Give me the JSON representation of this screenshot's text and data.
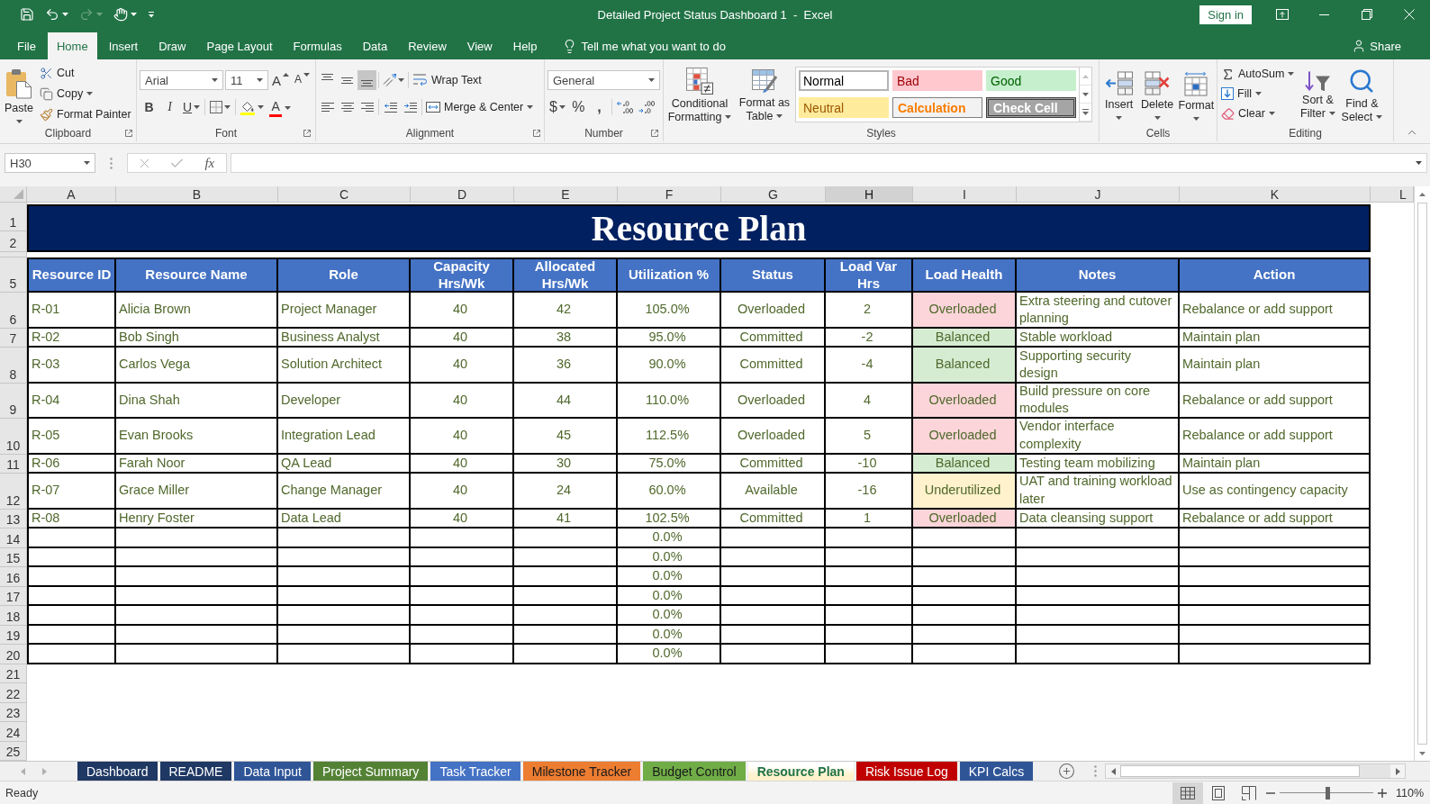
{
  "title_bar": {
    "quick_access": [
      {
        "kind": "save",
        "disabled": false
      },
      {
        "kind": "undo",
        "disabled": false
      },
      {
        "kind": "redo",
        "disabled": true
      },
      {
        "kind": "touch",
        "disabled": false
      }
    ],
    "title": "Detailed Project Status Dashboard 1  -  Excel",
    "sign_in": "Sign in"
  },
  "menu": {
    "tabs": [
      {
        "label": "File",
        "selected": false
      },
      {
        "label": "Home",
        "selected": true
      },
      {
        "label": "Insert",
        "selected": false
      },
      {
        "label": "Draw",
        "selected": false
      },
      {
        "label": "Page Layout",
        "selected": false
      },
      {
        "label": "Formulas",
        "selected": false
      },
      {
        "label": "Data",
        "selected": false
      },
      {
        "label": "Review",
        "selected": false
      },
      {
        "label": "View",
        "selected": false
      },
      {
        "label": "Help",
        "selected": false
      }
    ],
    "tell_me": "Tell me what you want to do",
    "share": "Share"
  },
  "ribbon": {
    "clipboard": {
      "label": "Clipboard",
      "paste": "Paste",
      "cut": "Cut",
      "copy": "Copy",
      "format_painter": "Format Painter"
    },
    "font": {
      "label": "Font",
      "font_name": "Arial",
      "font_size": "11",
      "grow": "A",
      "shrink": "A",
      "bold": "B",
      "italic": "I",
      "underline": "U",
      "font_color": "A"
    },
    "alignment": {
      "label": "Alignment",
      "vertical": [
        {
          "kind": "top",
          "selected": false
        },
        {
          "kind": "middle",
          "selected": false
        },
        {
          "kind": "bottom",
          "selected": true
        }
      ],
      "wrap_text": "Wrap Text",
      "merge_center": "Merge & Center"
    },
    "number": {
      "label": "Number",
      "format": "General",
      "currency": "$",
      "percent": "%",
      "comma": ","
    },
    "styles": {
      "label": "Styles",
      "conditional_formatting": "Conditional Formatting",
      "format_as_table": "Format as Table",
      "gallery": [
        {
          "label": "Normal",
          "kind": "normal",
          "selected": true
        },
        {
          "label": "Bad",
          "kind": "bad",
          "selected": false
        },
        {
          "label": "Good",
          "kind": "good",
          "selected": false
        },
        {
          "label": "Neutral",
          "kind": "neutral",
          "selected": false
        },
        {
          "label": "Calculation",
          "kind": "calculation",
          "selected": false
        },
        {
          "label": "Check Cell",
          "kind": "check",
          "selected": false
        }
      ]
    },
    "cells": {
      "label": "Cells",
      "insert": "Insert",
      "delete": "Delete",
      "format": "Format"
    },
    "editing": {
      "label": "Editing",
      "autosum": "AutoSum",
      "fill": "Fill",
      "clear": "Clear",
      "sort_filter": "Sort & Filter",
      "find_select": "Find & Select"
    }
  },
  "formula_bar": {
    "name_box": "H30",
    "function": "fx"
  },
  "sheet": {
    "columns": [
      {
        "label": "A",
        "selected": false
      },
      {
        "label": "B",
        "selected": false
      },
      {
        "label": "C",
        "selected": false
      },
      {
        "label": "D",
        "selected": false
      },
      {
        "label": "E",
        "selected": false
      },
      {
        "label": "F",
        "selected": false
      },
      {
        "label": "G",
        "selected": false
      },
      {
        "label": "H",
        "selected": true
      },
      {
        "label": "I",
        "selected": false
      },
      {
        "label": "J",
        "selected": false
      },
      {
        "label": "K",
        "selected": false
      },
      {
        "label": "L",
        "selected": false
      }
    ],
    "row_numbers": [
      "1",
      "2",
      "5",
      "6",
      "7",
      "8",
      "9",
      "10",
      "11",
      "12",
      "13",
      "14",
      "15",
      "16",
      "17",
      "18",
      "19",
      "20",
      "21",
      "22",
      "23",
      "24",
      "25"
    ],
    "title": "Resource Plan",
    "headers": [
      "Resource ID",
      "Resource Name",
      "Role",
      "Capacity Hrs/Wk",
      "Allocated Hrs/Wk",
      "Utilization %",
      "Status",
      "Load Var Hrs",
      "Load Health",
      "Notes",
      "Action"
    ],
    "rows": [
      {
        "resource_id": "R-01",
        "resource_name": "Alicia Brown",
        "role": "Project Manager",
        "capacity": "40",
        "allocated": "42",
        "utilization": "105.0%",
        "status": "Overloaded",
        "load_var": "2",
        "load_health": {
          "text": "Overloaded",
          "color": "#fbd5d9"
        },
        "notes": "Extra steering and cutover planning",
        "action": "Rebalance or add support"
      },
      {
        "resource_id": "R-02",
        "resource_name": "Bob Singh",
        "role": "Business Analyst",
        "capacity": "40",
        "allocated": "38",
        "utilization": "95.0%",
        "status": "Committed",
        "load_var": "-2",
        "load_health": {
          "text": "Balanced",
          "color": "#d6ecd2"
        },
        "notes": "Stable workload",
        "action": "Maintain plan"
      },
      {
        "resource_id": "R-03",
        "resource_name": "Carlos Vega",
        "role": "Solution Architect",
        "capacity": "40",
        "allocated": "36",
        "utilization": "90.0%",
        "status": "Committed",
        "load_var": "-4",
        "load_health": {
          "text": "Balanced",
          "color": "#d6ecd2"
        },
        "notes": "Supporting security design",
        "action": "Maintain plan"
      },
      {
        "resource_id": "R-04",
        "resource_name": "Dina Shah",
        "role": "Developer",
        "capacity": "40",
        "allocated": "44",
        "utilization": "110.0%",
        "status": "Overloaded",
        "load_var": "4",
        "load_health": {
          "text": "Overloaded",
          "color": "#fbd5d9"
        },
        "notes": "Build pressure on core modules",
        "action": "Rebalance or add support"
      },
      {
        "resource_id": "R-05",
        "resource_name": "Evan Brooks",
        "role": "Integration Lead",
        "capacity": "40",
        "allocated": "45",
        "utilization": "112.5%",
        "status": "Overloaded",
        "load_var": "5",
        "load_health": {
          "text": "Overloaded",
          "color": "#fbd5d9"
        },
        "notes": "Vendor interface complexity",
        "action": "Rebalance or add support"
      },
      {
        "resource_id": "R-06",
        "resource_name": "Farah Noor",
        "role": "QA Lead",
        "capacity": "40",
        "allocated": "30",
        "utilization": "75.0%",
        "status": "Committed",
        "load_var": "-10",
        "load_health": {
          "text": "Balanced",
          "color": "#d6ecd2"
        },
        "notes": "Testing team mobilizing",
        "action": "Maintain plan"
      },
      {
        "resource_id": "R-07",
        "resource_name": "Grace Miller",
        "role": "Change Manager",
        "capacity": "40",
        "allocated": "24",
        "utilization": "60.0%",
        "status": "Available",
        "load_var": "-16",
        "load_health": {
          "text": "Underutilized",
          "color": "#fff2cc"
        },
        "notes": "UAT and training workload later",
        "action": "Use as contingency capacity"
      },
      {
        "resource_id": "R-08",
        "resource_name": "Henry Foster",
        "role": "Data Lead",
        "capacity": "40",
        "allocated": "41",
        "utilization": "102.5%",
        "status": "Committed",
        "load_var": "1",
        "load_health": {
          "text": "Overloaded",
          "color": "#fbd5d9"
        },
        "notes": "Data cleansing support",
        "action": "Rebalance or add support"
      }
    ],
    "blank_rows": [
      {
        "utilization": "0.0%"
      },
      {
        "utilization": "0.0%"
      },
      {
        "utilization": "0.0%"
      },
      {
        "utilization": "0.0%"
      },
      {
        "utilization": "0.0%"
      },
      {
        "utilization": "0.0%"
      },
      {
        "utilization": "0.0%"
      }
    ]
  },
  "sheet_tabs": [
    {
      "label": "Dashboard",
      "color": "#1f3864",
      "selected": false
    },
    {
      "label": "README",
      "color": "#1f3864",
      "selected": false
    },
    {
      "label": "Data Input",
      "color": "#2f5597",
      "selected": false
    },
    {
      "label": "Project Summary",
      "color": "#548235",
      "selected": false
    },
    {
      "label": "Task Tracker",
      "color": "#4472c4",
      "selected": false
    },
    {
      "label": "Milestone Tracker",
      "color": "#ed7d31",
      "selected": false
    },
    {
      "label": "Budget Control",
      "color": "#70ad47",
      "selected": false
    },
    {
      "label": "Resource Plan",
      "color": "#fff2cc",
      "selected": true
    },
    {
      "label": "Risk Issue Log",
      "color": "#c00000",
      "selected": false
    },
    {
      "label": "KPI Calcs",
      "color": "#2f5597",
      "selected": false
    }
  ],
  "status_bar": {
    "status": "Ready",
    "views": [
      {
        "kind": "normal",
        "selected": true
      },
      {
        "kind": "page_layout",
        "selected": false
      },
      {
        "kind": "page_break",
        "selected": false
      }
    ],
    "zoom": {
      "level": 0.51,
      "label": "110%"
    }
  }
}
